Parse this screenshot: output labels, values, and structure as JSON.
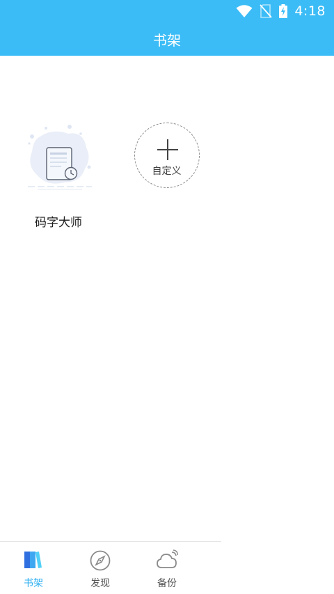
{
  "status_bar": {
    "time": "4:18"
  },
  "header": {
    "title": "书架"
  },
  "shelf": {
    "books": [
      {
        "title": "码字大师"
      }
    ],
    "custom_button": {
      "label": "自定义"
    }
  },
  "bottom_nav": {
    "items": [
      {
        "label": "书架",
        "icon": "bookshelf-icon",
        "active": true
      },
      {
        "label": "发现",
        "icon": "compass-icon",
        "active": false
      },
      {
        "label": "备份",
        "icon": "cloud-backup-icon",
        "active": false
      }
    ]
  },
  "colors": {
    "header": "#3bbcf6",
    "active": "#2aaef0",
    "inactive": "#555555"
  }
}
